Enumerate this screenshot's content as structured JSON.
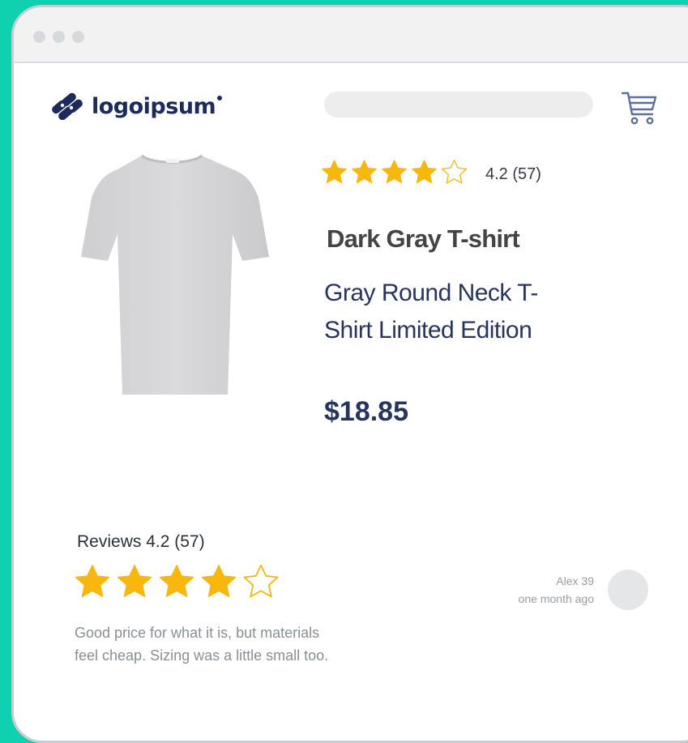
{
  "colors": {
    "page_background": "#0fd1b0",
    "star_filled": "#f8b70d",
    "brand_navy": "#1c2b5a",
    "text_navy": "#27355e"
  },
  "header": {
    "logo_text": "logoipsum",
    "logo_icon": "logo-mark-icon",
    "search_placeholder": "",
    "cart_icon": "cart-icon"
  },
  "product": {
    "image_icon": "t-shirt-image",
    "rating_text": "4.2 (57)",
    "stars": [
      true,
      true,
      true,
      true,
      false
    ],
    "title": "Dark Gray T-shirt",
    "description_lines": [
      "Gray Round Neck T-",
      "Shirt Limited Edition"
    ],
    "price": "$18.85"
  },
  "reviews": {
    "heading": "Reviews 4.2 (57)",
    "stars": [
      true,
      true,
      true,
      true,
      false
    ],
    "items": [
      {
        "reviewer": "Alex 39",
        "time": "one month ago",
        "text_lines": [
          "Good price for what it is, but materials",
          "feel cheap. Sizing was a little small too."
        ]
      }
    ]
  }
}
